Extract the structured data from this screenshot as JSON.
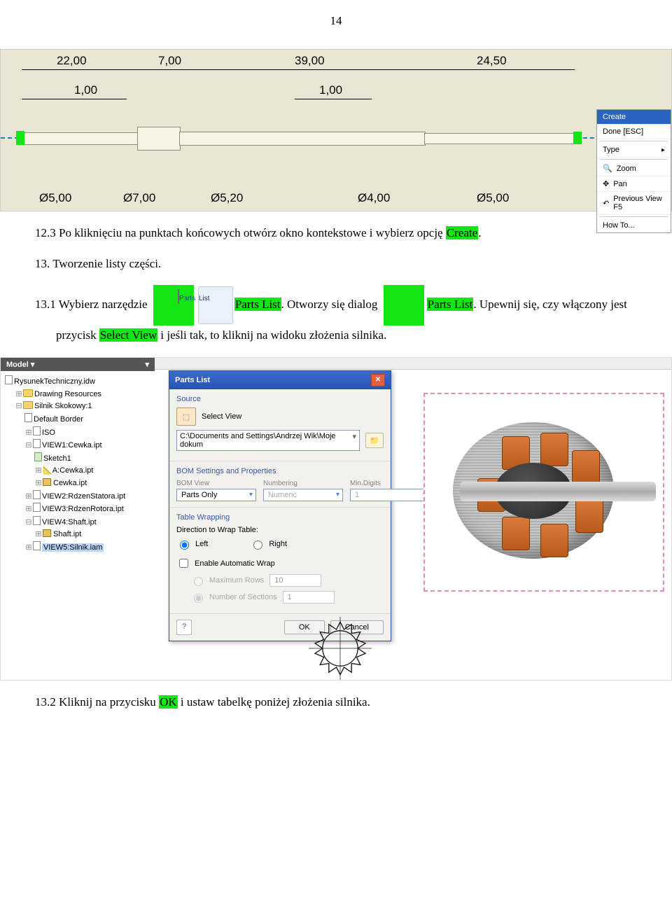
{
  "page_number": "14",
  "drawing": {
    "dims_top": [
      "22,00",
      "7,00",
      "39,00",
      "24,50"
    ],
    "dims_mid": [
      "1,00",
      "1,00"
    ],
    "dims_bottom": [
      "Ø5,00",
      "Ø7,00",
      "Ø5,20",
      "Ø4,00",
      "Ø5,00"
    ]
  },
  "context_menu": {
    "items": [
      "Create",
      "Done [ESC]",
      "Type",
      "Zoom",
      "Pan",
      "Previous View  F5",
      "How To..."
    ]
  },
  "para_12_3_a": "12.3  Po kliknięciu na punktach końcowych otwórz okno kontekstowe i wybierz opcję ",
  "para_12_3_b": "Create",
  "para_12_3_c": ".",
  "para_13": "13. Tworzenie listy części.",
  "icon_label_a": "Parts",
  "icon_label_b": "List",
  "para_13_1_a": "13.1  Wybierz narzędzie ",
  "para_13_1_b": "Parts List",
  "para_13_1_c": ". Otworzy się dialog ",
  "para_13_1_d": "Parts List",
  "para_13_1_e": ". Upewnij się, czy włączony jest przycisk ",
  "para_13_1_f": "Select View",
  "para_13_1_g": " i jeśli tak, to kliknij na widoku złożenia silnika.",
  "model_panel": {
    "title": "Model ▾",
    "items": [
      "RysunekTechniczny.idw",
      "Drawing Resources",
      "Silnik Skokowy:1",
      "Default Border",
      "ISO",
      "VIEW1:Cewka.ipt",
      "Sketch1",
      "A:Cewka.ipt",
      "Cewka.ipt",
      "VIEW2:RdzenStatora.ipt",
      "VIEW3:RdzenRotora.ipt",
      "VIEW4:Shaft.ipt",
      "Shaft.ipt",
      "VIEW5:Silnik.iam"
    ]
  },
  "dialog": {
    "title": "Parts List",
    "source": "Source",
    "select_view": "Select View",
    "path": "C:\\Documents and Settings\\Andrzej Wik\\Moje dokum",
    "bom_section": "BOM Settings and Properties",
    "bom_view_lbl": "BOM View",
    "numbering_lbl": "Numbering",
    "mindigits_lbl": "Min.Digits",
    "bom_view_val": "Parts Only",
    "numbering_val": "Numeric",
    "mindigits_val": "1",
    "wrap_section": "Table Wrapping",
    "wrap_dir": "Direction to Wrap Table:",
    "left": "Left",
    "right": "Right",
    "enable_auto": "Enable Automatic Wrap",
    "max_rows": "Maximum Rows",
    "max_rows_val": "10",
    "num_sections": "Number of Sections",
    "num_sections_val": "1",
    "ok": "OK",
    "cancel": "Cancel"
  },
  "para_13_2_a": "13.2  Kliknij na przycisku ",
  "para_13_2_b": "OK",
  "para_13_2_c": " i ustaw tabelkę poniżej złożenia silnika."
}
